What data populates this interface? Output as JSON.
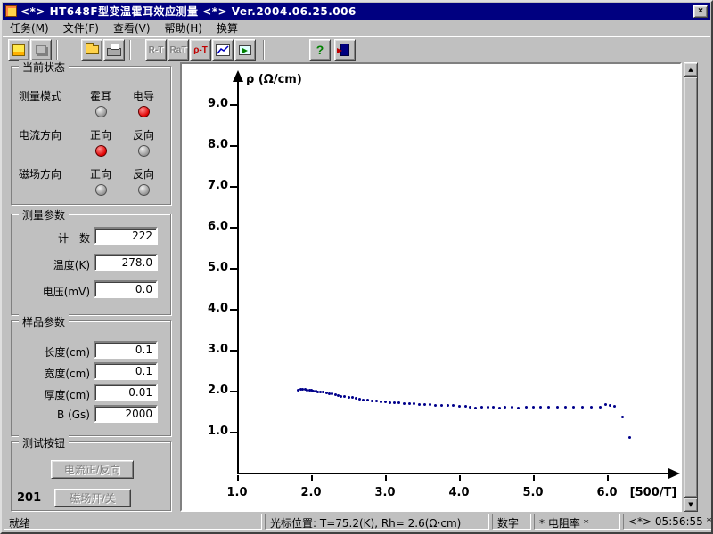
{
  "window": {
    "title": "<*> HT648F型变温霍耳效应测量 <*>  Ver.2004.06.25.006",
    "close_label": "×"
  },
  "menu": {
    "items": [
      {
        "label": "任务(M)"
      },
      {
        "label": "文件(F)"
      },
      {
        "label": "查看(V)"
      },
      {
        "label": "帮助(H)"
      },
      {
        "label": "换算"
      }
    ]
  },
  "toolbar": {
    "buttons": [
      {
        "name": "run",
        "label": ""
      },
      {
        "name": "stop",
        "label": ""
      },
      {
        "name": "open",
        "label": ""
      },
      {
        "name": "print",
        "label": ""
      },
      {
        "name": "rt",
        "label": "R-T"
      },
      {
        "name": "rat",
        "label": "RaT"
      },
      {
        "name": "rhot",
        "label": "ρ-T"
      },
      {
        "name": "graph",
        "label": ""
      },
      {
        "name": "export",
        "label": ""
      },
      {
        "name": "help",
        "label": "?"
      },
      {
        "name": "exit",
        "label": ""
      }
    ]
  },
  "scrollbar": {
    "up": "▲",
    "down": "▼"
  },
  "status_panel": {
    "title": "当前状态",
    "rows": [
      {
        "label": "测量模式",
        "opt1": "霍耳",
        "opt2": "电导",
        "led1": "gray",
        "led2": "red"
      },
      {
        "label": "电流方向",
        "opt1": "正向",
        "opt2": "反向",
        "led1": "red",
        "led2": "gray"
      },
      {
        "label": "磁场方向",
        "opt1": "正向",
        "opt2": "反向",
        "led1": "gray",
        "led2": "gray"
      }
    ]
  },
  "measure_params": {
    "title": "测量参数",
    "fields": [
      {
        "label": "计　数",
        "value": "222"
      },
      {
        "label": "温度(K)",
        "value": "278.0"
      },
      {
        "label": "电压(mV)",
        "value": "0.0"
      }
    ]
  },
  "sample_params": {
    "title": "样品参数",
    "fields": [
      {
        "label": "长度(cm)",
        "value": "0.1"
      },
      {
        "label": "宽度(cm)",
        "value": "0.1"
      },
      {
        "label": "厚度(cm)",
        "value": "0.01"
      },
      {
        "label": "B (Gs)",
        "value": "2000"
      }
    ]
  },
  "test_buttons": {
    "title": "测试按钮",
    "current_button": "电流正/反向",
    "counter": "201",
    "field_button": "磁场开/关"
  },
  "chart_data": {
    "type": "scatter",
    "title": "",
    "ylabel": "ρ (Ω/cm)",
    "xlabel": "[500/T]",
    "x_ticks": [
      "1.0",
      "2.0",
      "3.0",
      "4.0",
      "5.0",
      "6.0"
    ],
    "y_ticks": [
      "9.0",
      "8.0",
      "7.0",
      "6.0",
      "5.0",
      "4.0",
      "3.0",
      "2.0",
      "1.0"
    ],
    "xlim": [
      1.0,
      6.9
    ],
    "ylim": [
      0,
      9.6
    ],
    "grid": false,
    "legend": false,
    "marker_color": "#00008b",
    "points": [
      [
        1.82,
        2.05
      ],
      [
        1.85,
        2.06
      ],
      [
        1.88,
        2.06
      ],
      [
        1.91,
        2.06
      ],
      [
        1.94,
        2.05
      ],
      [
        1.97,
        2.05
      ],
      [
        2.0,
        2.04
      ],
      [
        2.03,
        2.03
      ],
      [
        2.06,
        2.02
      ],
      [
        2.09,
        2.01
      ],
      [
        2.12,
        2.0
      ],
      [
        2.16,
        1.99
      ],
      [
        2.2,
        1.98
      ],
      [
        2.24,
        1.96
      ],
      [
        2.28,
        1.95
      ],
      [
        2.32,
        1.93
      ],
      [
        2.36,
        1.92
      ],
      [
        2.4,
        1.9
      ],
      [
        2.45,
        1.89
      ],
      [
        2.5,
        1.87
      ],
      [
        2.55,
        1.86
      ],
      [
        2.6,
        1.84
      ],
      [
        2.65,
        1.83
      ],
      [
        2.7,
        1.81
      ],
      [
        2.76,
        1.8
      ],
      [
        2.82,
        1.79
      ],
      [
        2.88,
        1.78
      ],
      [
        2.94,
        1.77
      ],
      [
        3.0,
        1.76
      ],
      [
        3.06,
        1.75
      ],
      [
        3.12,
        1.74
      ],
      [
        3.18,
        1.73
      ],
      [
        3.25,
        1.72
      ],
      [
        3.32,
        1.71
      ],
      [
        3.39,
        1.71
      ],
      [
        3.46,
        1.7
      ],
      [
        3.53,
        1.69
      ],
      [
        3.6,
        1.69
      ],
      [
        3.68,
        1.68
      ],
      [
        3.76,
        1.68
      ],
      [
        3.84,
        1.67
      ],
      [
        3.92,
        1.67
      ],
      [
        4.0,
        1.66
      ],
      [
        4.08,
        1.65
      ],
      [
        4.15,
        1.62
      ],
      [
        4.22,
        1.6
      ],
      [
        4.3,
        1.63
      ],
      [
        4.38,
        1.62
      ],
      [
        4.46,
        1.64
      ],
      [
        4.54,
        1.6
      ],
      [
        4.62,
        1.62
      ],
      [
        4.71,
        1.63
      ],
      [
        4.8,
        1.61
      ],
      [
        4.9,
        1.63
      ],
      [
        5.0,
        1.62
      ],
      [
        5.1,
        1.64
      ],
      [
        5.21,
        1.62
      ],
      [
        5.32,
        1.63
      ],
      [
        5.43,
        1.62
      ],
      [
        5.54,
        1.63
      ],
      [
        5.66,
        1.62
      ],
      [
        5.78,
        1.63
      ],
      [
        5.9,
        1.64
      ],
      [
        5.98,
        1.7
      ],
      [
        6.04,
        1.68
      ],
      [
        6.1,
        1.66
      ],
      [
        6.2,
        1.4
      ],
      [
        6.3,
        0.9
      ]
    ]
  },
  "statusbar": {
    "ready": "就绪",
    "cursor_info": "光标位置: T=75.2(K), Rh= 2.6(Ω·cm)",
    "numlock": "数字",
    "mode": "* 电阻率 *",
    "time": "<*> 05:56:55 *"
  }
}
